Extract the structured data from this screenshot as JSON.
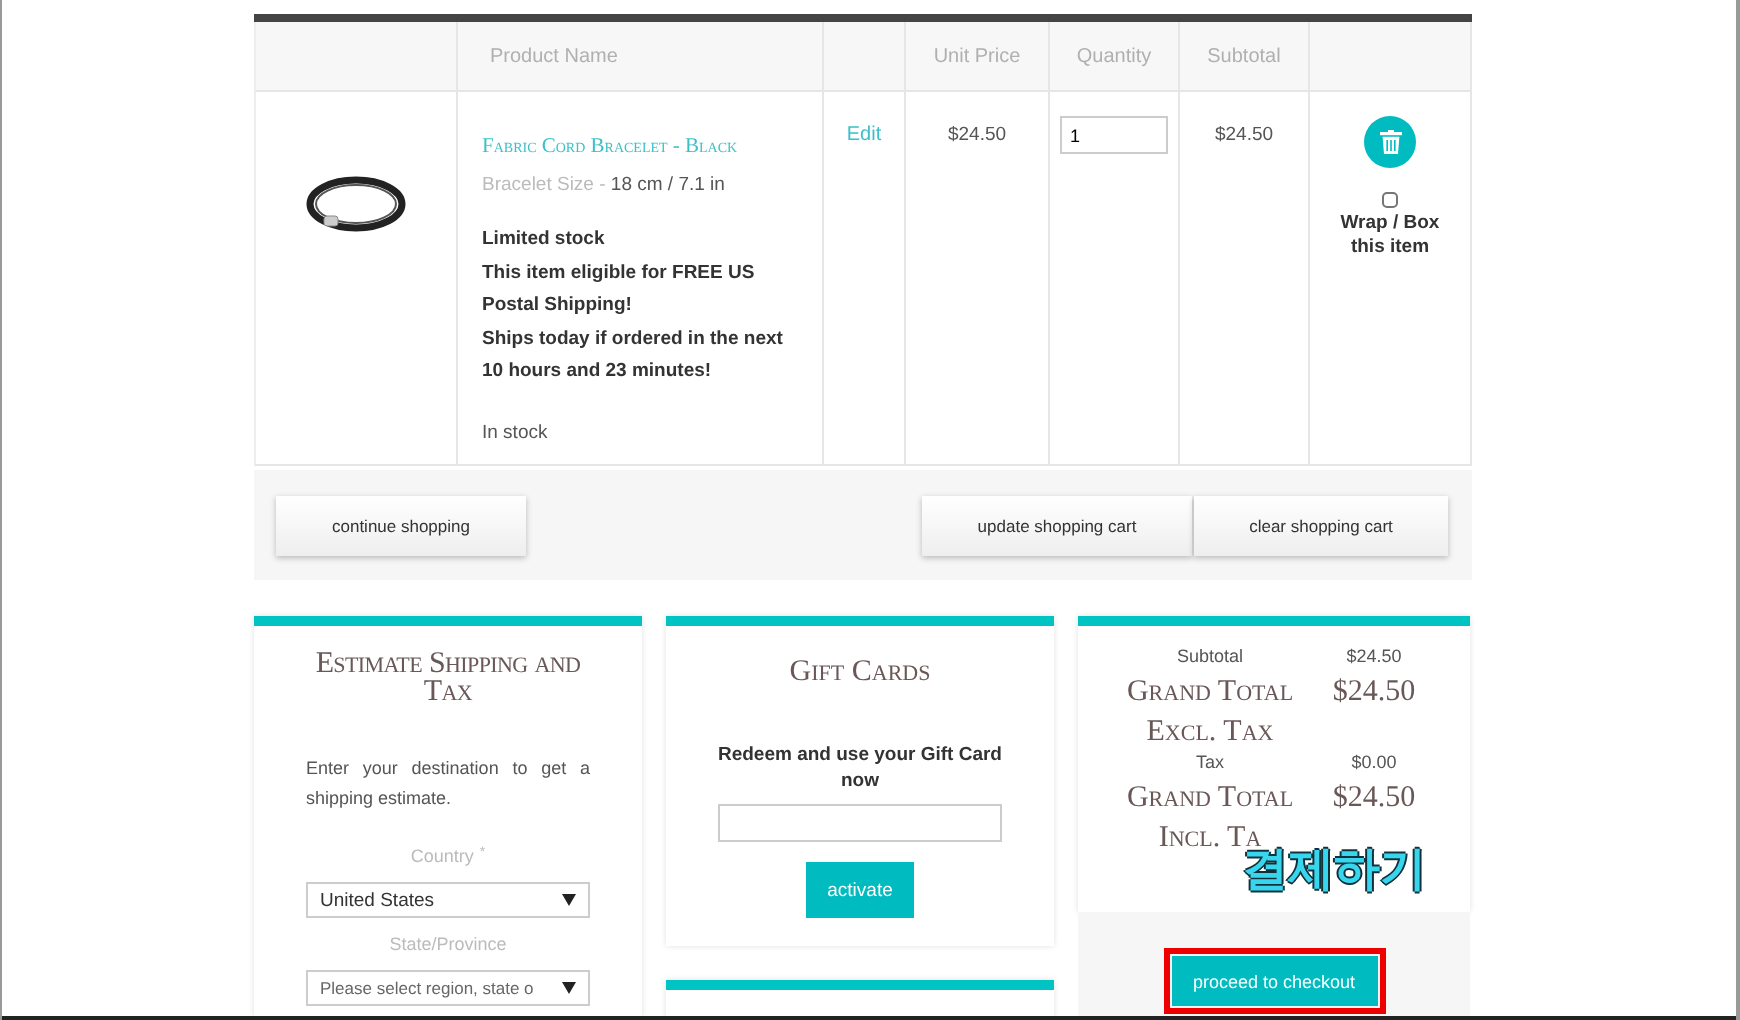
{
  "cart": {
    "columns": [
      {
        "kind": "image"
      },
      {
        "kind": "name",
        "label": "Product Name"
      },
      {
        "kind": "edit"
      },
      {
        "kind": "price",
        "label": "Unit Price"
      },
      {
        "kind": "qty",
        "label": "Quantity"
      },
      {
        "kind": "subtotal",
        "label": "Subtotal"
      },
      {
        "kind": "actions"
      }
    ],
    "item": {
      "name": "Fabric Cord Bracelet - Black",
      "option_label": "Bracelet Size -",
      "option_value": "18 cm / 7.1 in",
      "notes": [
        "Limited stock",
        "This item eligible for FREE US Postal Shipping!",
        "Ships today if ordered in the next 10 hours and 23 minutes!"
      ],
      "availability": "In stock",
      "edit": "Edit",
      "unit_price": "$24.50",
      "quantity": "1",
      "subtotal": "$24.50",
      "gift_wrap": {
        "label": "Wrap / Box this item",
        "checked": false
      }
    }
  },
  "actions": [
    "continue shopping",
    "update shopping cart",
    "clear shopping cart"
  ],
  "shipping": {
    "title": "Estimate Shipping and Tax",
    "intro": "Enter your destination to get a shipping estimate.",
    "country_label": "Country",
    "required_mark": "*",
    "country": "United States",
    "state_label": "State/Province",
    "state": "Please select region, state o"
  },
  "gift_cards": {
    "title": "Gift Cards",
    "prompt": "Redeem and use your Gift Card now",
    "button": "activate"
  },
  "totals": {
    "rows": [
      {
        "kind": "minor",
        "label": "Subtotal",
        "value": "$24.50"
      },
      {
        "kind": "grand",
        "label": "Grand Total Excl. Tax",
        "value": "$24.50"
      },
      {
        "kind": "minor",
        "label": "Tax",
        "value": "$0.00"
      },
      {
        "kind": "grand",
        "label": "Grand Total Incl. Ta",
        "value": "$24.50"
      }
    ],
    "checkout": "proceed to checkout"
  },
  "annotation": {
    "label": "결제하기"
  }
}
